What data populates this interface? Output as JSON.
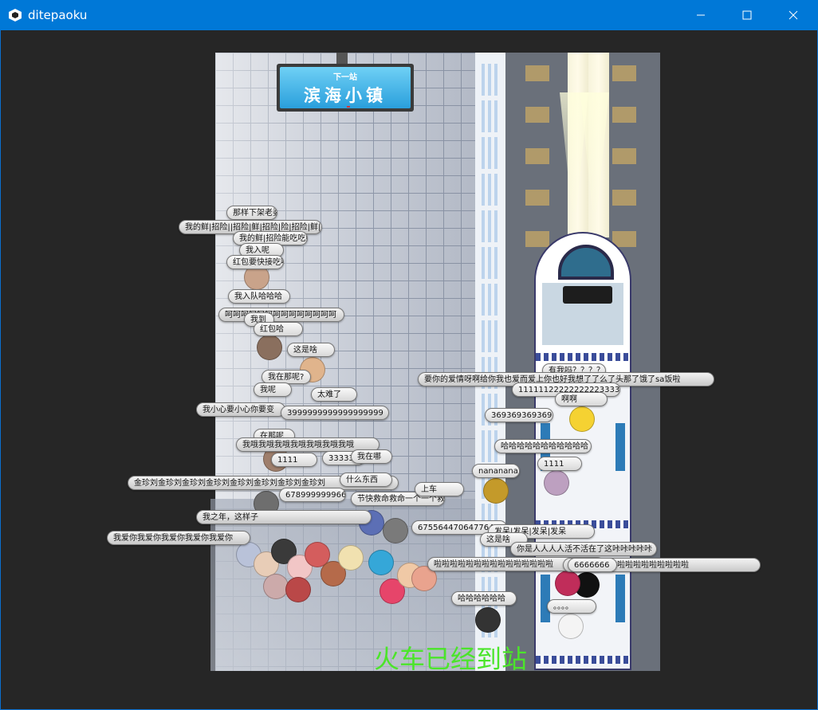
{
  "window": {
    "title": "ditepaoku",
    "minimize_icon": "minimize-icon",
    "maximize_icon": "maximize-icon",
    "close_icon": "close-icon"
  },
  "station_sign": {
    "small": "下一站",
    "big": "滨海小镇"
  },
  "subtitle": "火车已经到站",
  "subtitle_color": "#4be52a",
  "bubbles_left": [
    "那样下架老婆",
    "我的鲜|招险||招险|鲜|招险|险|招险|鲜|招险",
    "我的鲜|招险能吃吃鲜",
    "我入呢",
    "红包要快接吃啊",
    "我入队哈哈哈",
    "呵呵呵呵呵呵呵呵呵呵呵呵呵呵",
    "我到",
    "红包哈",
    "这是啥",
    "我在那呢?",
    "我呢",
    "太难了",
    "我小心要小心你要变",
    "3999999999999999999",
    "在那呢",
    "我哦我哦我哦我哦我哦我哦我哦",
    "1111",
    "3333333",
    "我在哪",
    "金珍刘金珍刘金珍刘金珍刘金珍刘金珍刘金珍刘金珍刘",
    "什么东西",
    "678999999966",
    "节快救命救命一个一个救命!",
    "上车",
    "我之年，这样子",
    "我爱你我爱你我爱你我爱你我爱你"
  ],
  "bubbles_right": [
    "有我吗？？？？？",
    "要你的爱情呀啊给你我也爱而爱上你也好我想了了么了头那了饿了sa饭啦",
    "11111122222222223333333",
    "啊啊",
    "3693693693693",
    "哈哈哈哈哈哈哈哈哈哈哈",
    "1111",
    "nananana",
    "675564470647764476",
    "发呆|发呆|发呆|发呆",
    "这是啥",
    "你是人人人人活不活在了这咔咔咔咔咔",
    "啦啦啦啦啦啦啦啦啦啦啦啦啦啦啦",
    "6666666",
    "哈哈哈哈哈哈",
    "。。。。"
  ]
}
